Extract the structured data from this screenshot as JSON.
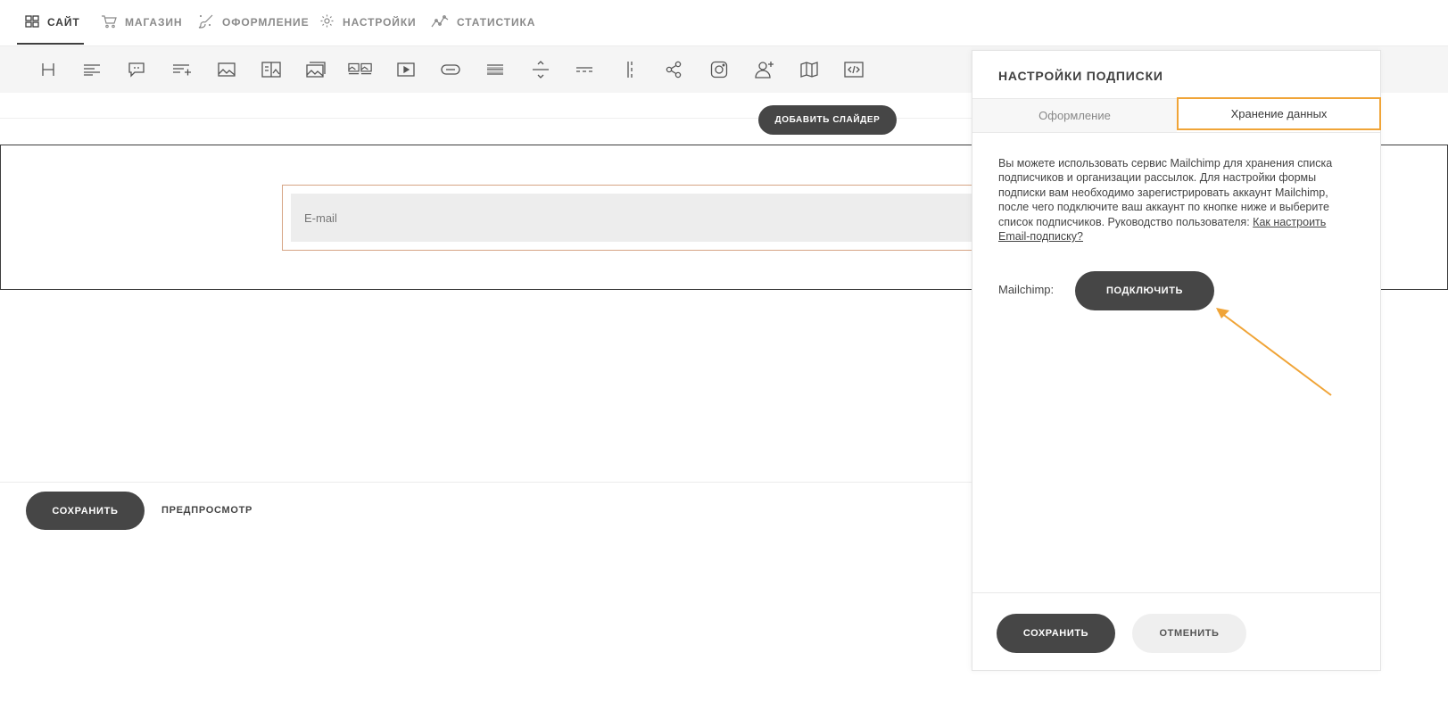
{
  "nav": {
    "items": [
      {
        "label": "САЙТ",
        "icon": "grid-icon",
        "active": true
      },
      {
        "label": "МАГАЗИН",
        "icon": "cart-icon"
      },
      {
        "label": "ОФОРМЛЕНИЕ",
        "icon": "brush-icon"
      },
      {
        "label": "НАСТРОЙКИ",
        "icon": "gear-icon"
      },
      {
        "label": "СТАТИСТИКА",
        "icon": "chart-line-icon"
      }
    ]
  },
  "toolbar": {
    "tools": [
      "heading-icon",
      "text-icon",
      "quote-icon",
      "list-icon",
      "image-icon",
      "image-text-icon",
      "gallery-icon",
      "gallery-text-icon",
      "video-icon",
      "button-icon",
      "form-icon",
      "divider-icon",
      "spacer-icon",
      "columns-icon",
      "share-icon",
      "instagram-icon",
      "subscribe-icon",
      "map-icon",
      "code-icon"
    ]
  },
  "editor": {
    "add_slider": "ДОБАВИТЬ СЛАЙДЕР",
    "email_placeholder": "E-mail",
    "save": "СОХРАНИТЬ",
    "preview": "ПРЕДПРОСМОТР"
  },
  "panel": {
    "title": "НАСТРОЙКИ ПОДПИСКИ",
    "tabs": {
      "design": "Оформление",
      "storage": "Хранение данных"
    },
    "description": "Вы можете использовать сервис Mailchimp для хранения списка подписчиков и организации рассылок. Для настройки формы подписки вам необходимо зарегистрировать аккаунт Mailchimp, после чего подключите ваш аккаунт по кнопке ниже и выберите список подписчиков. Руководство пользователя: ",
    "help_link": "Как настроить Email-подписку?",
    "mailchimp_label": "Mailchimp:",
    "connect": "ПОДКЛЮЧИТЬ",
    "save": "СОХРАНИТЬ",
    "cancel": "ОТМЕНИТЬ"
  },
  "colors": {
    "accent": "#f0a437",
    "button_dark": "#464646",
    "email_frame": "#d6a484"
  }
}
